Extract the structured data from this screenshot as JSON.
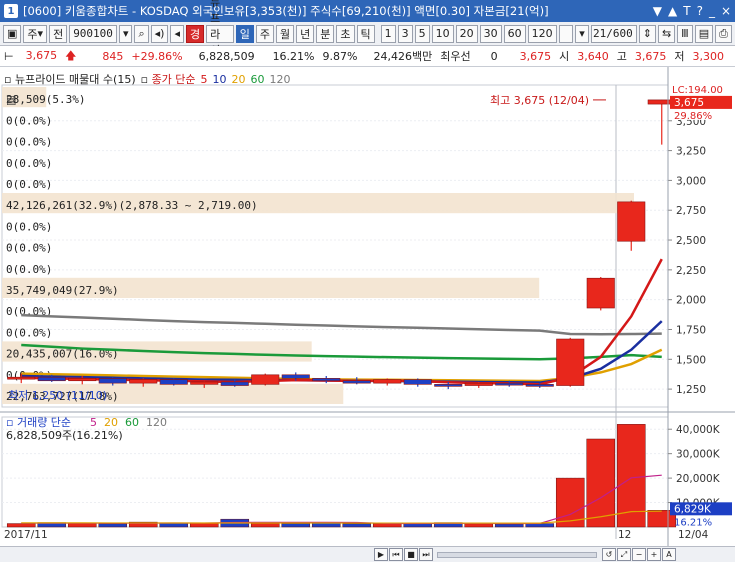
{
  "window": {
    "number": "1",
    "title": "[0600] 키움종합차트 - KOSDAQ 외국인보유[3,353(천)] 주식수[69,210(천)] 액면[0.30] 자본금[21(억)]",
    "controls": [
      "▼",
      "▲",
      "T",
      "?",
      "_",
      "×"
    ]
  },
  "toolbar": {
    "period_select": "주",
    "market_label": "전",
    "code_value": "900100",
    "news_tab": "경",
    "name_value": "뉴프라이드",
    "period_buttons": [
      "일",
      "주",
      "월",
      "년",
      "분",
      "초",
      "틱"
    ],
    "active_period": "일",
    "interval_buttons": [
      "1",
      "3",
      "5",
      "10",
      "20",
      "30",
      "60",
      "120"
    ],
    "count_value": "21/600"
  },
  "quote": {
    "price": "3,675",
    "change": "845",
    "change_pct": "+29.86%",
    "volume": "6,828,509",
    "vol_ratio": "16.21%",
    "turnover": "9.87%",
    "amount": "24,426백만",
    "pref_label": "최우선",
    "pref_value": "0",
    "ask": "3,675",
    "open_label": "시",
    "open": "3,640",
    "high_label": "고",
    "high": "3,675",
    "low_label": "저",
    "low": "3,300"
  },
  "legend": {
    "profile_label": "뉴프라이드 매물대 수(15)",
    "ma_label": "종가 단순",
    "ma_periods": [
      "5",
      "10",
      "20",
      "60",
      "120"
    ],
    "ma_colors": [
      "#d41818",
      "#1a2fa0",
      "#e0a000",
      "#1a9a3a",
      "#7a7a7a"
    ]
  },
  "volume_profile": [
    {
      "text": "28,509(5.3%)",
      "frac": 0.07
    },
    {
      "text": "0(0.0%)",
      "frac": 0
    },
    {
      "text": "0(0.0%)",
      "frac": 0
    },
    {
      "text": "0(0.0%)",
      "frac": 0
    },
    {
      "text": "0(0.0%)",
      "frac": 0
    },
    {
      "text": "42,126,261(32.9%)(2,878.33 ~ 2,719.00)",
      "frac": 1.0
    },
    {
      "text": "0(0.0%)",
      "frac": 0
    },
    {
      "text": "0(0.0%)",
      "frac": 0
    },
    {
      "text": "0(0.0%)",
      "frac": 0
    },
    {
      "text": "35,749,049(27.9%)",
      "frac": 0.85
    },
    {
      "text": "0(0.0%)",
      "frac": 0
    },
    {
      "text": "0(0.0%)",
      "frac": 0
    },
    {
      "text": "20,435,007(16.0%)",
      "frac": 0.49
    },
    {
      "text": "0(0.0%)",
      "frac": 0
    },
    {
      "text": "22,763,727(17.8%)",
      "frac": 0.54
    }
  ],
  "price_axis": {
    "ticks": [
      "3,500",
      "3,250",
      "3,000",
      "2,750",
      "2,500",
      "2,250",
      "2,000",
      "1,750",
      "1,500",
      "1,250"
    ],
    "lc_label": "LC:194.00",
    "current_price": "3,675",
    "current_pct": "29.86%"
  },
  "annotations": {
    "high": "최고 3,675 (12/04)",
    "low": "최저 1,250 (11/10)"
  },
  "volume_panel": {
    "legend_label": "거래량 단순",
    "ma_periods": [
      "5",
      "20",
      "60",
      "120"
    ],
    "ma_colors": [
      "#c0208a",
      "#e0a000",
      "#1a9a3a",
      "#7a7a7a"
    ],
    "value_text": "6,828,509주(16.21%)",
    "ticks": [
      "40,000K",
      "30,000K",
      "20,000K",
      "10,000K"
    ],
    "current_value": "6,829K",
    "current_pct": "16.21%"
  },
  "x_axis": {
    "left_label": "2017/11",
    "mid_label": "12",
    "right_label": "12/04"
  },
  "chart_data": {
    "type": "candlestick",
    "candles": [
      {
        "o": 1340,
        "h": 1380,
        "l": 1300,
        "c": 1350
      },
      {
        "o": 1350,
        "h": 1370,
        "l": 1310,
        "c": 1320
      },
      {
        "o": 1320,
        "h": 1360,
        "l": 1290,
        "c": 1340
      },
      {
        "o": 1340,
        "h": 1350,
        "l": 1280,
        "c": 1300
      },
      {
        "o": 1300,
        "h": 1340,
        "l": 1270,
        "c": 1330
      },
      {
        "o": 1330,
        "h": 1340,
        "l": 1280,
        "c": 1290
      },
      {
        "o": 1290,
        "h": 1320,
        "l": 1260,
        "c": 1310
      },
      {
        "o": 1310,
        "h": 1330,
        "l": 1270,
        "c": 1280
      },
      {
        "o": 1290,
        "h": 1380,
        "l": 1280,
        "c": 1370
      },
      {
        "o": 1370,
        "h": 1390,
        "l": 1320,
        "c": 1340
      },
      {
        "o": 1340,
        "h": 1360,
        "l": 1300,
        "c": 1320
      },
      {
        "o": 1320,
        "h": 1350,
        "l": 1290,
        "c": 1300
      },
      {
        "o": 1300,
        "h": 1340,
        "l": 1280,
        "c": 1330
      },
      {
        "o": 1330,
        "h": 1340,
        "l": 1270,
        "c": 1290
      },
      {
        "o": 1290,
        "h": 1310,
        "l": 1250,
        "c": 1280
      },
      {
        "o": 1280,
        "h": 1310,
        "l": 1260,
        "c": 1300
      },
      {
        "o": 1300,
        "h": 1320,
        "l": 1270,
        "c": 1290
      },
      {
        "o": 1290,
        "h": 1300,
        "l": 1260,
        "c": 1280
      },
      {
        "o": 1280,
        "h": 1680,
        "l": 1270,
        "c": 1670
      },
      {
        "o": 1930,
        "h": 2190,
        "l": 1910,
        "c": 2180
      },
      {
        "o": 2490,
        "h": 2830,
        "l": 2410,
        "c": 2820
      },
      {
        "o": 3640,
        "h": 3675,
        "l": 3300,
        "c": 3675
      }
    ],
    "volumes_k": [
      1400,
      1800,
      1500,
      1300,
      2000,
      1600,
      1700,
      3200,
      1500,
      1400,
      1600,
      1300,
      1400,
      1500,
      1800,
      1300,
      1200,
      1400,
      20000,
      36000,
      42000,
      6829
    ],
    "ma5": [
      1345,
      1340,
      1335,
      1330,
      1325,
      1320,
      1315,
      1310,
      1318,
      1325,
      1322,
      1318,
      1322,
      1318,
      1308,
      1300,
      1298,
      1290,
      1350,
      1520,
      1860,
      2340
    ],
    "ma10": [
      1360,
      1355,
      1350,
      1345,
      1340,
      1335,
      1330,
      1328,
      1326,
      1324,
      1322,
      1320,
      1318,
      1316,
      1313,
      1310,
      1308,
      1305,
      1340,
      1420,
      1580,
      1820
    ],
    "ma20": [
      1380,
      1375,
      1370,
      1365,
      1360,
      1355,
      1350,
      1345,
      1340,
      1335,
      1332,
      1330,
      1328,
      1326,
      1324,
      1322,
      1320,
      1318,
      1345,
      1390,
      1460,
      1580
    ],
    "ma60": [
      1620,
      1605,
      1590,
      1580,
      1570,
      1560,
      1552,
      1545,
      1538,
      1532,
      1527,
      1522,
      1518,
      1514,
      1510,
      1507,
      1504,
      1500,
      1508,
      1520,
      1535,
      1520
    ],
    "ma120": [
      1870,
      1860,
      1850,
      1840,
      1830,
      1820,
      1812,
      1805,
      1798,
      1790,
      1783,
      1776,
      1770,
      1764,
      1758,
      1752,
      1746,
      1740,
      1712,
      1710,
      1712,
      1715
    ],
    "vol_ma5": [
      1600,
      1600,
      1550,
      1550,
      1600,
      1640,
      1620,
      1860,
      1900,
      1880,
      1880,
      1840,
      1440,
      1440,
      1500,
      1460,
      1440,
      1440,
      5140,
      11940,
      20120,
      21200
    ],
    "vol_ma20": [
      1700,
      1690,
      1680,
      1670,
      1660,
      1650,
      1645,
      1640,
      1635,
      1630,
      1625,
      1620,
      1615,
      1610,
      1605,
      1600,
      1598,
      1596,
      2500,
      4200,
      6300,
      6500
    ],
    "ylim": [
      1100,
      3800
    ],
    "vol_ylim": [
      0,
      45000
    ]
  }
}
